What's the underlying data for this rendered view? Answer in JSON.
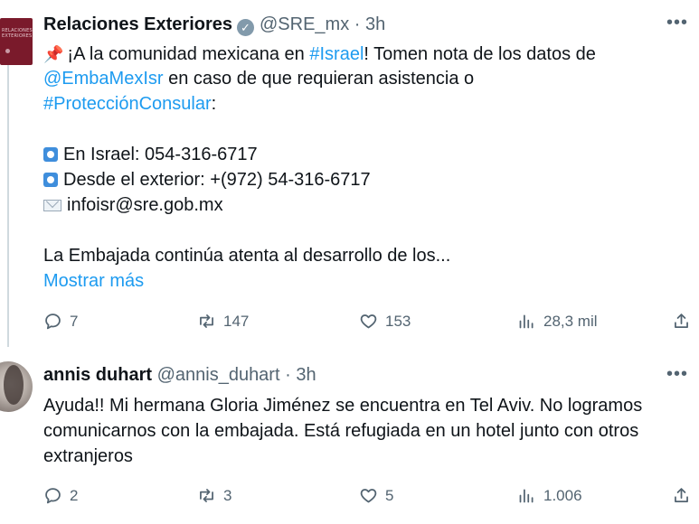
{
  "tweet1": {
    "display_name": "Relaciones Exteriores",
    "handle": "@SRE_mx",
    "separator": "·",
    "time": "3h",
    "avatar_logo_text": "RELACIONES EXTERIORES",
    "line1_pre": "¡A la comunidad mexicana en ",
    "line1_hashtag": "#Israel",
    "line1_post": "! Tomen nota de los datos de",
    "line2_mention": "@EmbaMexIsr",
    "line2_post": " en caso de que requieran asistencia o",
    "line3_hashtag": "#ProtecciónConsular",
    "line3_post": ":",
    "contact1": "En Israel: 054-316-6717",
    "contact2": "Desde el exterior: +(972) 54-316-6717",
    "contact3": "infoisr@sre.gob.mx",
    "body_end": "La Embajada continúa atenta al desarrollo de los...",
    "show_more": "Mostrar más",
    "replies": "7",
    "retweets": "147",
    "likes": "153",
    "views": "28,3 mil"
  },
  "tweet2": {
    "display_name": "annis duhart",
    "handle": "@annis_duhart",
    "separator": "·",
    "time": "3h",
    "text_line1": "Ayuda!! Mi hermana Gloria Jiménez se encuentra en Tel Aviv. No logramos",
    "text_line2": "comunicarnos con la embajada. Está refugiada en un hotel junto con otros",
    "text_line3": "extranjeros",
    "replies": "2",
    "retweets": "3",
    "likes": "5",
    "views": "1.006"
  },
  "icons": {
    "verified": "verified-badge-icon",
    "more": "more-options-icon",
    "pin": "pushpin-icon",
    "info_box": "blue-square-icon",
    "envelope": "envelope-icon",
    "reply": "reply-icon",
    "retweet": "retweet-icon",
    "like": "heart-icon",
    "views": "views-icon",
    "share": "share-icon"
  },
  "colors": {
    "link": "#1d9bf0",
    "muted": "#536471",
    "text": "#0f1419",
    "avatar_brand": "#7a1a2b"
  }
}
